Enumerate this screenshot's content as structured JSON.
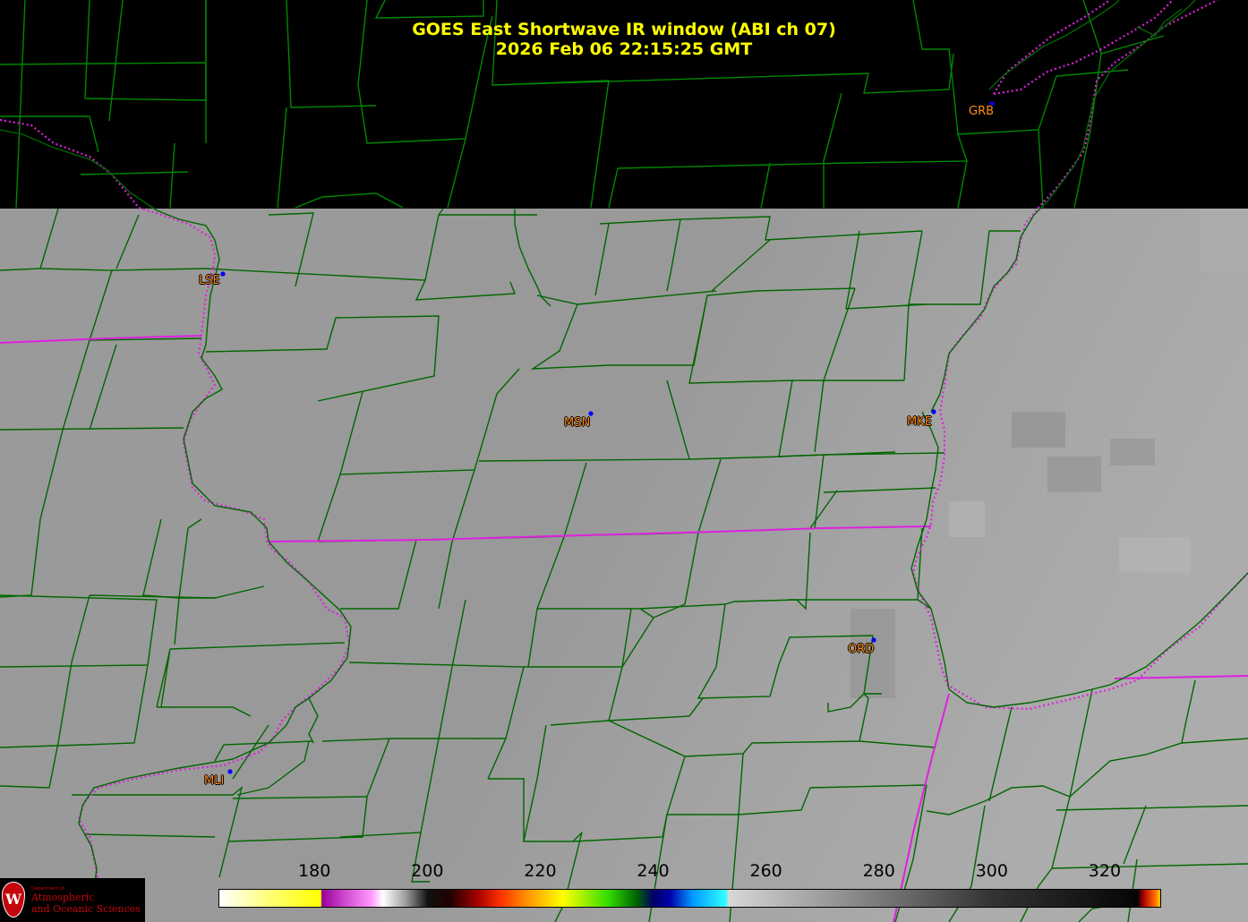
{
  "header": {
    "title_line1": "GOES East Shortwave IR window (ABI ch 07)",
    "title_line2": "2026 Feb 06  22:15:25 GMT"
  },
  "stations": [
    {
      "code": "GRB"
    },
    {
      "code": "LSE"
    },
    {
      "code": "MSN"
    },
    {
      "code": "MKE"
    },
    {
      "code": "ORD"
    },
    {
      "code": "MLI"
    }
  ],
  "colorbar": {
    "ticks": [
      "180",
      "200",
      "220",
      "240",
      "260",
      "280",
      "300",
      "320"
    ],
    "range": [
      163,
      330
    ],
    "stops": [
      {
        "v": 163,
        "c": "#ffffff"
      },
      {
        "v": 173,
        "c": "#ffff66"
      },
      {
        "v": 181,
        "c": "#ffff00"
      },
      {
        "v": 181.2,
        "c": "#990099"
      },
      {
        "v": 185,
        "c": "#cc44cc"
      },
      {
        "v": 190,
        "c": "#ff99ff"
      },
      {
        "v": 192,
        "c": "#ffffff"
      },
      {
        "v": 196,
        "c": "#a0a0a0"
      },
      {
        "v": 200,
        "c": "#111111"
      },
      {
        "v": 204,
        "c": "#220000"
      },
      {
        "v": 209,
        "c": "#aa0000"
      },
      {
        "v": 213,
        "c": "#ff3300"
      },
      {
        "v": 218,
        "c": "#ff9900"
      },
      {
        "v": 224,
        "c": "#ffff00"
      },
      {
        "v": 232,
        "c": "#33dd00"
      },
      {
        "v": 237,
        "c": "#006600"
      },
      {
        "v": 240,
        "c": "#000066"
      },
      {
        "v": 243,
        "c": "#0000aa"
      },
      {
        "v": 247,
        "c": "#0099ff"
      },
      {
        "v": 253,
        "c": "#33ffff"
      },
      {
        "v": 253.3,
        "c": "#d8d8d8"
      },
      {
        "v": 260,
        "c": "#c0c0c0"
      },
      {
        "v": 280,
        "c": "#7a7a7a"
      },
      {
        "v": 300,
        "c": "#333333"
      },
      {
        "v": 326,
        "c": "#050505"
      },
      {
        "v": 327,
        "c": "#aa0000"
      },
      {
        "v": 329,
        "c": "#ff6600"
      },
      {
        "v": 330,
        "c": "#ffcc00"
      }
    ]
  },
  "logo": {
    "seal_letter": "W",
    "dept_text": "Department of",
    "line1": "Atmospheric",
    "line2": "and Oceanic Sciences"
  },
  "colors": {
    "title": "#ffff00",
    "county_lines": "#008800",
    "state_lines": "#e020e0",
    "station_dot": "#0000ff",
    "station_label": "#ff8c1a",
    "imagery": "#9c9c9c"
  }
}
